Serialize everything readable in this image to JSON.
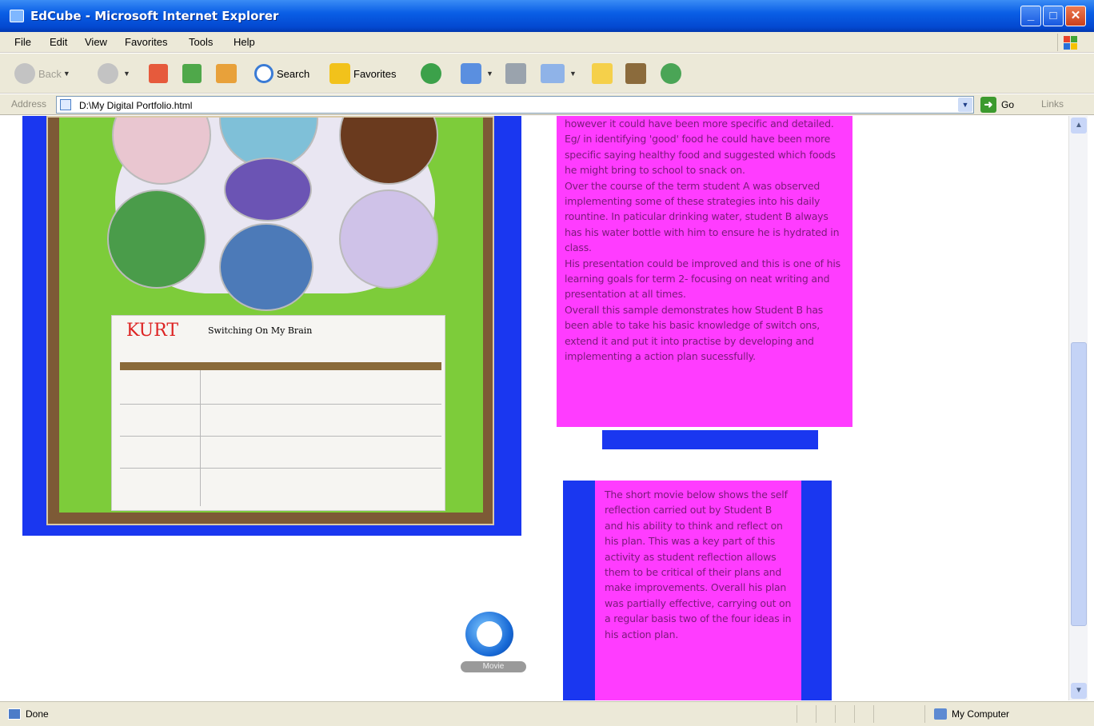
{
  "window": {
    "title": "EdCube - Microsoft Internet Explorer",
    "min": "_",
    "max": "□",
    "close": "✕"
  },
  "menu": [
    "File",
    "Edit",
    "View",
    "Favorites",
    "Tools",
    "Help"
  ],
  "toolbar": {
    "back": "Back",
    "search": "Search",
    "favorites": "Favorites"
  },
  "address": {
    "label": "Address",
    "value": "D:\\My Digital Portfolio.html",
    "go": "Go",
    "links": "Links"
  },
  "poster": {
    "name": "KURT",
    "title": "Switching On My Brain"
  },
  "box1_paragraphs": [
    "however it could have been more specific and detailed. Eg/ in identifying 'good' food he could have been more specific saying healthy food and suggested which foods he might bring to school to snack on.",
    "Over the course of the term student A was observed implementing some of these strategies into his daily rountine. In paticular drinking water, student B always has his water bottle with him to ensure he is hydrated in class.",
    "His presentation could be improved and this is one of his learning goals for term 2- focusing on neat writing and presentation at all times.",
    "Overall this sample demonstrates how Student B has been able to take his basic knowledge of switch ons, extend it and put it into practise by developing and implementing a action plan sucessfully."
  ],
  "box2_text": "The short movie below shows the self reflection carried out by Student B and his ability to think and reflect on his plan. This was a key part of this activity as student reflection allows them to be critical of their plans and make improvements. Overall his plan was partially effective, carrying out on a regular basis two of the four ideas in his action plan.",
  "movie_label": "Movie",
  "status": {
    "left": "Done",
    "right": "My Computer"
  },
  "colors": {
    "frame_blue": "#1a37f0",
    "box_magenta": "#ff3cff",
    "box_text": "#7a1a7a"
  }
}
